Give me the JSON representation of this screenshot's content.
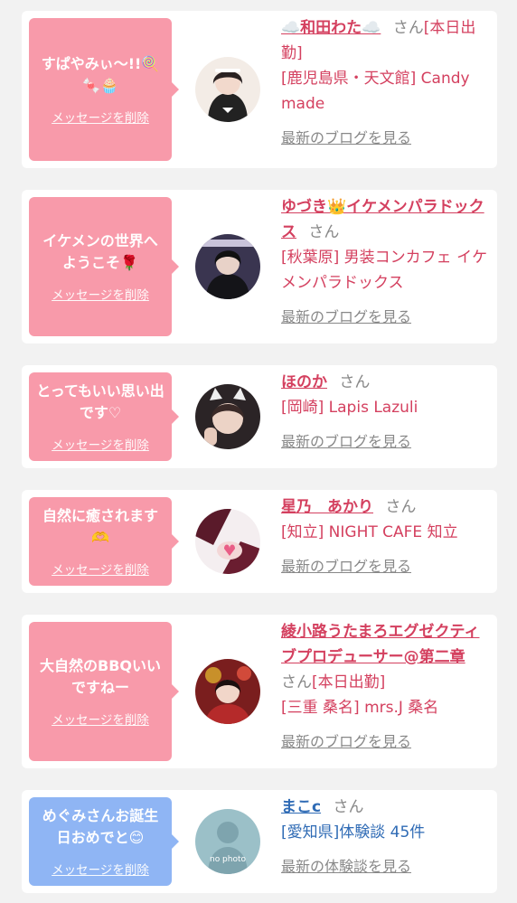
{
  "delete_label": "メッセージを削除",
  "blog_label": "最新のブログを見る",
  "review_label": "最新の体験談を見る",
  "san_label": "さん",
  "colors": {
    "pink": "#f89aaa",
    "blue": "#8fb5f4",
    "pink_text": "#d4405f",
    "blue_text": "#2f6bb5"
  },
  "items": [
    {
      "message": "すぱやみぃ〜!!🍭🍬🧁",
      "name": "☁️和田わた☁️",
      "status": "[本日出勤]",
      "shop": "[鹿児島県・天文館] Candy made"
    },
    {
      "message": "イケメンの世界へようこそ🌹",
      "name": "ゆづき👑イケメンパラドックス",
      "status": "",
      "shop": "[秋葉原] 男装コンカフェ イケメンパラドックス"
    },
    {
      "message": "とってもいい思い出です♡",
      "name": "ほのか",
      "status": "",
      "shop": "[岡崎] Lapis Lazuli"
    },
    {
      "message": "自然に癒されます🫶",
      "name": "星乃　あかり",
      "status": "",
      "shop": "[知立] NIGHT CAFE 知立"
    },
    {
      "message": "大自然のBBQいいですねー",
      "name": "綾小路うたまろエグゼクティブプロデューサー@第二章",
      "status": "[本日出勤]",
      "shop": "[三重 桑名] mrs.J 桑名"
    },
    {
      "message": "めぐみさんお誕生日おめでと😊",
      "name": "まこc",
      "status": "",
      "shop": "[愛知県]体験談 45件",
      "avatar_text": "no photo"
    }
  ]
}
